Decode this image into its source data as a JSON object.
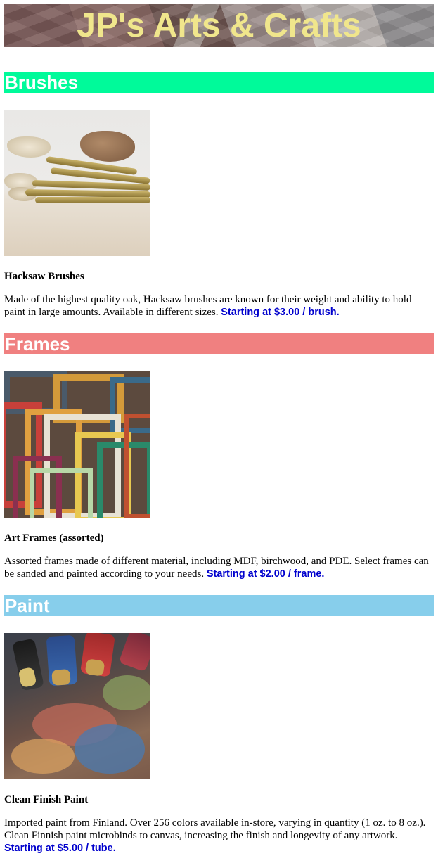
{
  "site": {
    "title": "JP's Arts & Crafts",
    "colors": {
      "title_text": "#f0e68c"
    }
  },
  "sections": [
    {
      "heading": "Brushes",
      "heading_color": "#00fa9a",
      "product": {
        "image_name": "brushes-photo",
        "title": "Hacksaw Brushes",
        "description": "Made of the highest quality oak, Hacksaw brushes are known for their weight and ability to hold paint in large amounts. Available in different sizes.",
        "price": "Starting at $3.00 / brush."
      }
    },
    {
      "heading": "Frames",
      "heading_color": "#f08080",
      "product": {
        "image_name": "frames-photo",
        "title": "Art Frames (assorted)",
        "description": "Assorted frames made of different material, including MDF, birchwood, and PDE. Select frames can be sanded and painted according to your needs.",
        "price": "Starting at $2.00 / frame."
      }
    },
    {
      "heading": "Paint",
      "heading_color": "#87ceeb",
      "product": {
        "image_name": "paint-photo",
        "title": "Clean Finish Paint",
        "description": "Imported paint from Finland. Over 256 colors available in-store, varying in quantity (1 oz. to 8 oz.). Clean Finnish paint microbinds to canvas, increasing the finish and longevity of any artwork.",
        "price": "Starting at $5.00 / tube."
      }
    }
  ],
  "price_color": "#0000cd"
}
